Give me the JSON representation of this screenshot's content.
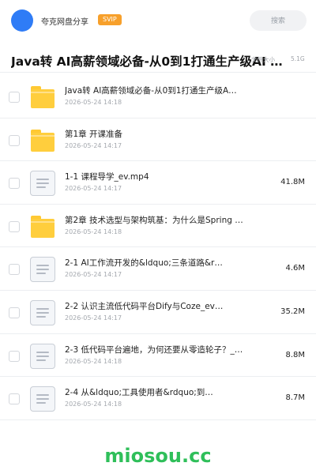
{
  "header": {
    "site_name": "夸克网盘分享",
    "badge": "SVIP",
    "search_placeholder": "搜索"
  },
  "folder": {
    "title": "Java转 AI高薪领域必备-从0到1打通生产级AI Agent",
    "meta_label": "文件大小",
    "meta_size": "5.1G"
  },
  "items": [
    {
      "type": "folder",
      "name": "Java转 AI高薪领域必备-从0到1打通生产级A…",
      "date": "2026-05-24 14:18",
      "size": ""
    },
    {
      "type": "folder",
      "name": "第1章 开课准备",
      "date": "2026-05-24 14:17",
      "size": ""
    },
    {
      "type": "file",
      "name": "1-1 课程导学_ev.mp4",
      "date": "2026-05-24 14:17",
      "size": "41.8M"
    },
    {
      "type": "folder",
      "name": "第2章 技术选型与架构筑基：为什么是Spring …",
      "date": "2026-05-24 14:18",
      "size": ""
    },
    {
      "type": "file",
      "name": "2-1 AI工作流开发的&ldquo;三条道路&r…",
      "date": "2026-05-24 14:17",
      "size": "4.6M"
    },
    {
      "type": "file",
      "name": "2-2 认识主流低代码平台Dify与Coze_ev…",
      "date": "2026-05-24 14:17",
      "size": "35.2M"
    },
    {
      "type": "file",
      "name": "2-3 低代码平台遍地，为何还要从零造轮子？_ev…",
      "date": "2026-05-24 14:18",
      "size": "8.8M"
    },
    {
      "type": "file",
      "name": "2-4 从&ldquo;工具使用者&rdquo;到…",
      "date": "2026-05-24 14:18",
      "size": "8.7M"
    }
  ],
  "watermark": "miosou.cc",
  "colors": {
    "brand": "#2f7cf6",
    "svip": "#f7a02b",
    "folder": "#ffce3d",
    "watermark": "#2fbf5a"
  },
  "icons": {
    "folder": "folder-icon",
    "file": "document-icon"
  }
}
